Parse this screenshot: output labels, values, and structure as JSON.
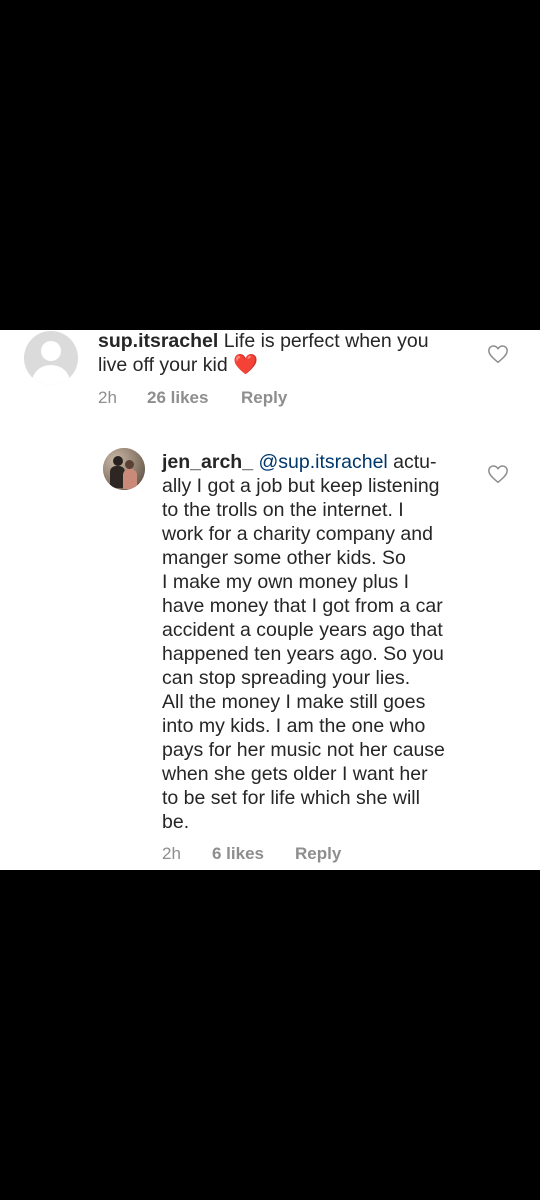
{
  "comments": [
    {
      "username": "sup.itsrachel",
      "text": "Life is perfect when you\nlive off your kid",
      "emoji": "❤️",
      "time": "2h",
      "likes": "26 likes",
      "reply": "Reply"
    }
  ],
  "replies": [
    {
      "username": "jen_arch_",
      "mention": "@sup.itsrachel",
      "text_first": "actu-",
      "text_rest": "ally I got a job but keep listening\nto the trolls on the internet. I\nwork for a charity company and\nmanger some other kids. So\nI make my own money plus I\nhave money that I got from a car\naccident a couple years ago that\nhappened ten years ago. So you\ncan stop spreading your lies.\nAll the money I make still goes\ninto my kids. I am the one who\npays for her music not her cause\nwhen she gets older I want her\nto be set for life which she will\nbe.",
      "time": "2h",
      "likes": "6 likes",
      "reply": "Reply"
    }
  ],
  "icons": {
    "avatar_default": "default-avatar-icon",
    "avatar_photo": "profile-photo",
    "like": "heart-outline-icon"
  },
  "colors": {
    "background": "#000000",
    "panel": "#ffffff",
    "text": "#262626",
    "secondary_text": "#8e8e8e",
    "mention": "#00376b",
    "emoji_heart": "#e0132a"
  }
}
